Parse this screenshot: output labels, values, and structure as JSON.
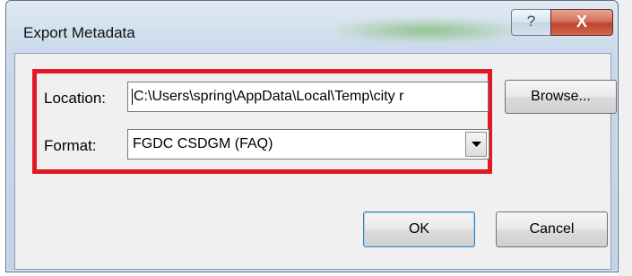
{
  "window": {
    "title": "Export Metadata",
    "help_label": "?",
    "close_label": "X"
  },
  "form": {
    "location_label": "Location:",
    "location_value": "C:\\Users\\spring\\AppData\\Local\\Temp\\city r",
    "format_label": "Format:",
    "format_selected": "FGDC CSDGM (FAQ)"
  },
  "buttons": {
    "browse": "Browse...",
    "ok": "OK",
    "cancel": "Cancel"
  },
  "colors": {
    "highlight_border": "#e01a24",
    "close_button": "#c0432d",
    "dialog_chrome": "#c9d9ea",
    "client_background": "#f0f0f0"
  },
  "icons": [
    "help-icon",
    "close-icon",
    "dropdown-arrow-icon"
  ]
}
